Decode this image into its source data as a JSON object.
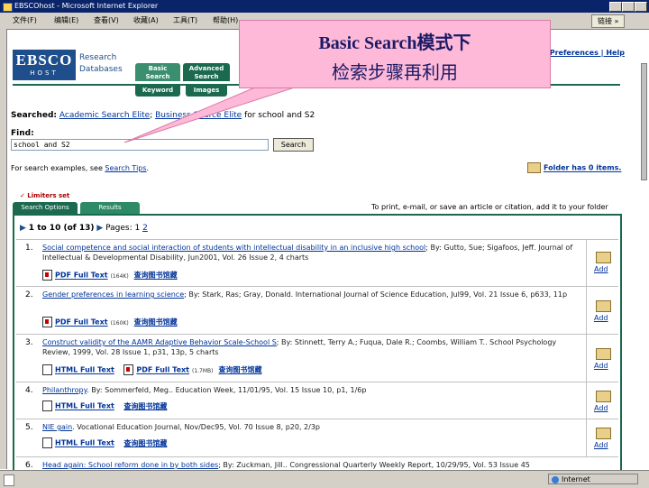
{
  "window": {
    "title": "EBSCOhost - Microsoft Internet Explorer",
    "menu": [
      "文件(F)",
      "编辑(E)",
      "查看(V)",
      "收藏(A)",
      "工具(T)",
      "帮助(H)"
    ],
    "goto_label": "链接 »",
    "status_zone": "Internet"
  },
  "header": {
    "logo_top": "EBSCO",
    "logo_bottom": "HOST",
    "logo_text": "Research Databases",
    "tabs": [
      "Basic Search",
      "Advanced Search"
    ],
    "subtabs": [
      "Keyword",
      "Images"
    ],
    "toplinks": "| Preferences | Help"
  },
  "callout": {
    "line1": "Basic Search模式下",
    "line2": "检索步骤再利用"
  },
  "search": {
    "searched_prefix": "Searched:",
    "db1": "Academic Search Elite",
    "db2": "Business Source Elite",
    "searched_suffix": "for school and S2",
    "find_label": "Find:",
    "query": "school and S2",
    "button": "Search",
    "examples_prefix": "For search examples, see",
    "examples_link": "Search Tips",
    "folder_link": "Folder has 0 items."
  },
  "results": {
    "limiters": "✓ Limiters set",
    "tab_search_options": "Search Options",
    "tab_results": "Results",
    "print_note": "To print, e-mail, or save an article or citation, add it to your folder",
    "pager_range": "1 to 10 (of 13)",
    "pager_label": "Pages: 1",
    "pager_page2": "2",
    "add_label": "Add",
    "items": [
      {
        "num": "1.",
        "title": "Social competence and social interaction of students with intellectual disability in an inclusive high school",
        "meta": "; By: Gutto, Sue; Sigafoos, Jeff. Journal of Intellectual & Developmental Disability, Jun2001, Vol. 26 Issue 2, 4 charts",
        "links": [
          {
            "type": "pdf",
            "label": "PDF Full Text",
            "size": "(164K)"
          },
          {
            "type": "local",
            "label": "查询图书馆藏"
          }
        ]
      },
      {
        "num": "2.",
        "title": "Gender preferences in learning science",
        "meta": "; By: Stark, Ras; Gray, Donald. International Journal of Science Education, Jul99, Vol. 21 Issue 6, p633, 11p",
        "links": [
          {
            "type": "pdf",
            "label": "PDF Full Text",
            "size": "(160K)"
          },
          {
            "type": "local",
            "label": "查询图书馆藏"
          }
        ]
      },
      {
        "num": "3.",
        "title": "Construct validity of the AAMR Adaptive Behavior Scale-School S",
        "meta": "; By: Stinnett, Terry A.; Fuqua, Dale R.; Coombs, William T.. School Psychology Review, 1999, Vol. 28 Issue 1, p31, 13p, 5 charts",
        "links": [
          {
            "type": "html",
            "label": "HTML Full Text"
          },
          {
            "type": "pdf",
            "label": "PDF Full Text",
            "size": "(1.7MB)"
          },
          {
            "type": "local",
            "label": "查询图书馆藏"
          }
        ]
      },
      {
        "num": "4.",
        "title": "Philanthropy",
        "meta": ". By: Sommerfeld, Meg.. Education Week, 11/01/95, Vol. 15 Issue 10, p1, 1/6p",
        "links": [
          {
            "type": "html",
            "label": "HTML Full Text"
          },
          {
            "type": "local",
            "label": "查询图书馆藏"
          }
        ]
      },
      {
        "num": "5.",
        "title": "NIE gain",
        "meta": ". Vocational Education Journal, Nov/Dec95, Vol. 70 Issue 8, p20, 2/3p",
        "links": [
          {
            "type": "html",
            "label": "HTML Full Text"
          },
          {
            "type": "local",
            "label": "查询图书馆藏"
          }
        ]
      },
      {
        "num": "6.",
        "title": "Head again: School reform done in by both sides",
        "meta": "; By: Zuckman, Jill.. Congressional Quarterly Weekly Report, 10/29/95, Vol. 53 Issue 45",
        "links": []
      }
    ]
  },
  "colors": {
    "ebsco_blue": "#1e4f8c",
    "ebsco_green": "#1b6a50",
    "callout_pink": "#ffb9d8",
    "link": "#003399"
  }
}
